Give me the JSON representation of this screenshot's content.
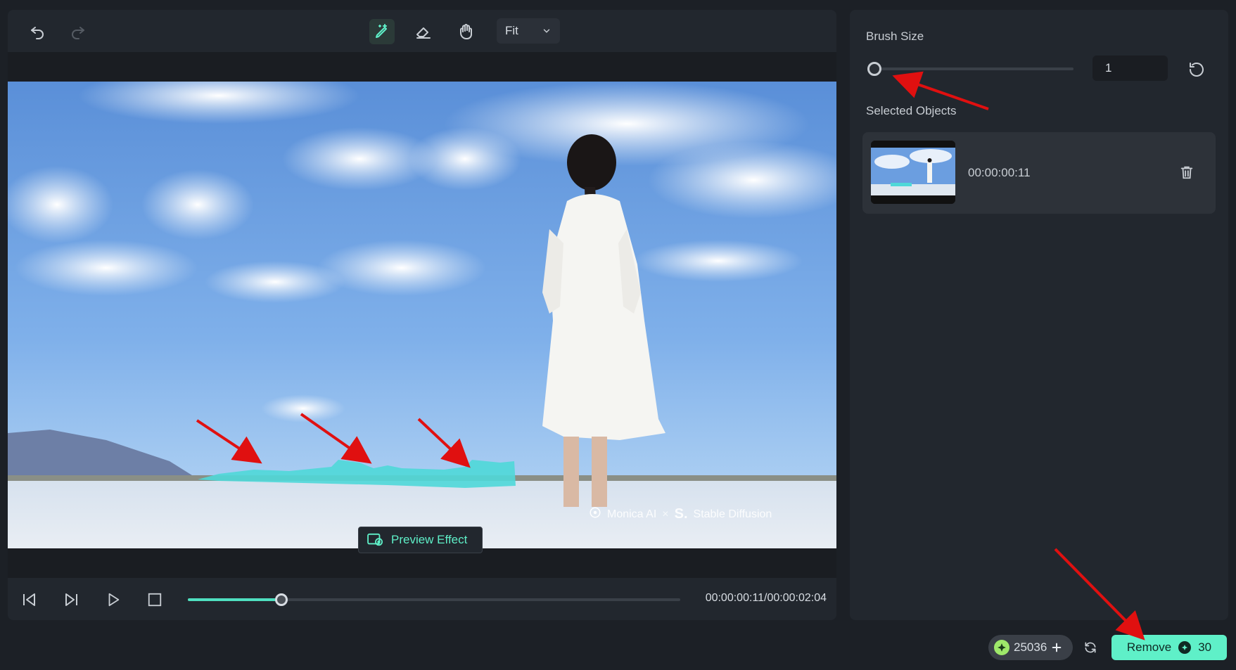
{
  "toolbar": {
    "undo_icon": "undo-icon",
    "redo_icon": "redo-icon",
    "smart_brush_icon": "smart-brush-icon",
    "eraser_icon": "eraser-icon",
    "hand_icon": "hand-icon",
    "zoom_select": "Fit"
  },
  "preview": {
    "preview_button_label": "Preview Effect",
    "watermark_left": "Monica AI",
    "watermark_sep": "×",
    "watermark_mark": "S.",
    "watermark_right": "Stable Diffusion"
  },
  "playback": {
    "progress_fraction": 0.19,
    "timecode": "00:00:00:11/00:00:02:04"
  },
  "side_panel": {
    "brush_size_label": "Brush Size",
    "brush_size_value": "1",
    "brush_size_fraction": 0.0,
    "selected_objects_label": "Selected Objects",
    "objects": [
      {
        "time": "00:00:00:11"
      }
    ]
  },
  "footer": {
    "credits": "25036",
    "remove_label": "Remove",
    "remove_cost": "30"
  },
  "colors": {
    "accent": "#5ff0c8",
    "panel": "#22272e",
    "background": "#1c2026",
    "annotation_arrow": "#e01010"
  }
}
